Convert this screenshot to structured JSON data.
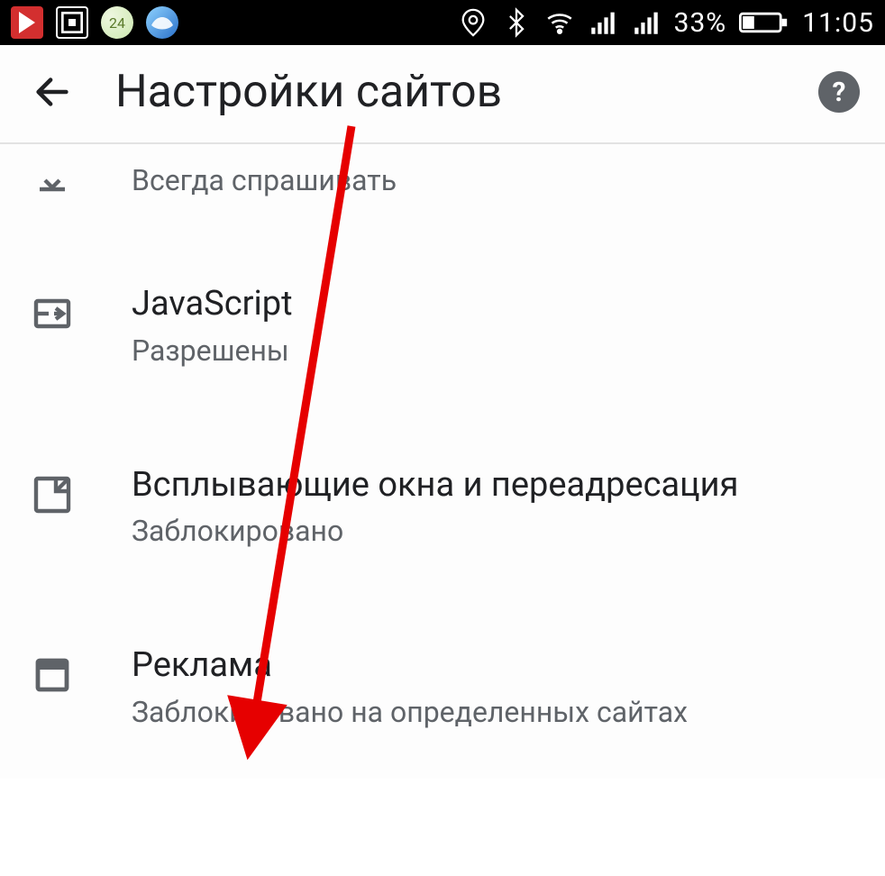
{
  "status": {
    "battery_pct": "33%",
    "time": "11:05"
  },
  "header": {
    "title": "Настройки сайтов"
  },
  "rows": {
    "truncated_sub": "Всегда спрашивать",
    "javascript": {
      "title": "JavaScript",
      "sub": "Разрешены"
    },
    "popups": {
      "title": "Всплывающие окна и переадресация",
      "sub": "Заблокировано"
    },
    "ads": {
      "title": "Реклама",
      "sub": "Заблокировано на определенных сайтах"
    }
  }
}
